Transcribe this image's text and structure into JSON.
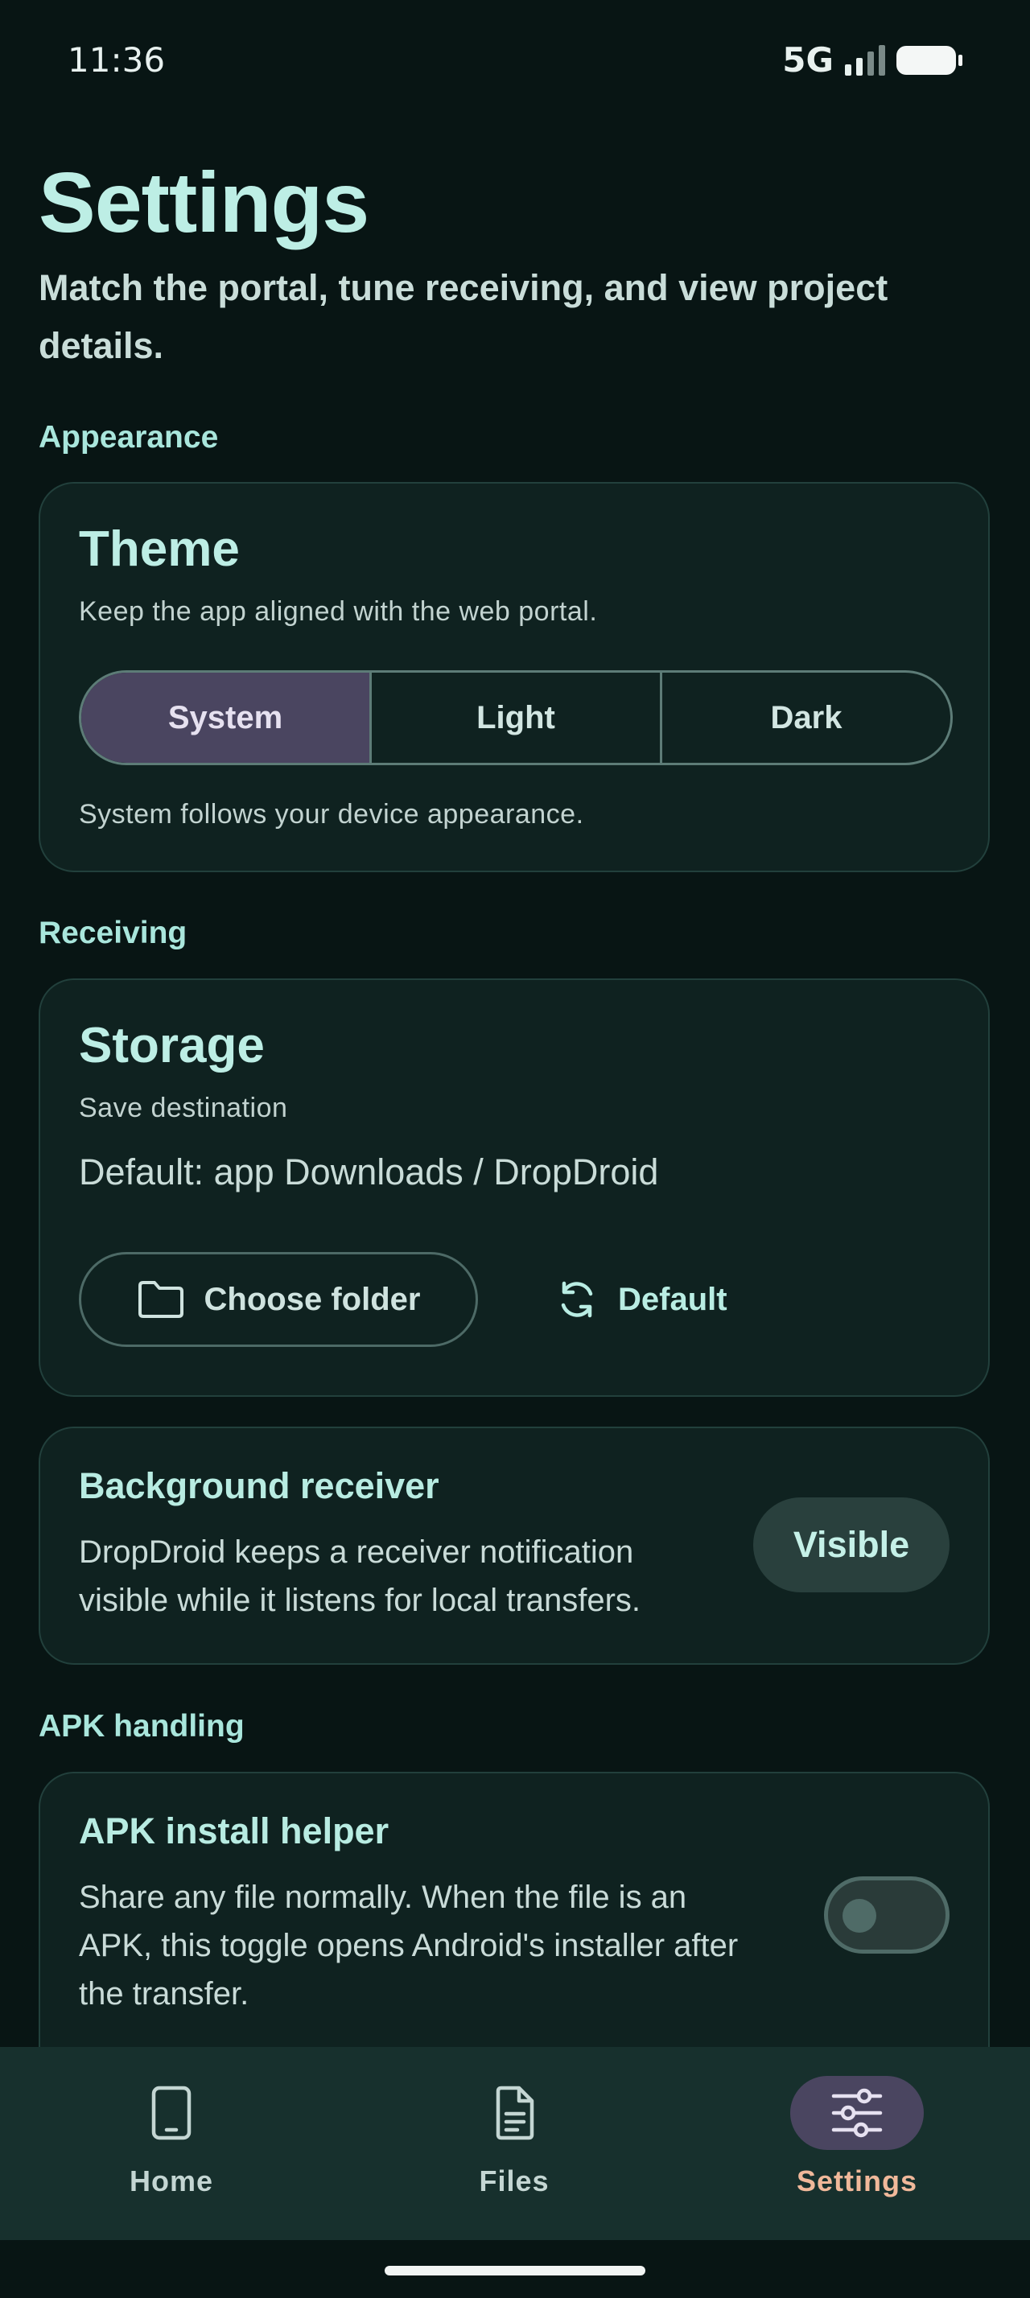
{
  "status_bar": {
    "time": "11:36",
    "network": "5G"
  },
  "header": {
    "title": "Settings",
    "subtitle": "Match the portal, tune receiving, and view project details."
  },
  "appearance": {
    "section_label": "Appearance",
    "card_title": "Theme",
    "card_desc": "Keep the app aligned with the web portal.",
    "options": [
      "System",
      "Light",
      "Dark"
    ],
    "selected": "System",
    "hint": "System follows your device appearance."
  },
  "receiving": {
    "section_label": "Receiving",
    "storage": {
      "title": "Storage",
      "subtitle": "Save destination",
      "path": "Default: app Downloads / DropDroid",
      "choose_label": "Choose folder",
      "default_label": "Default"
    },
    "background": {
      "title": "Background receiver",
      "desc": "DropDroid keeps a receiver notification visible while it listens for local transfers.",
      "button_label": "Visible"
    }
  },
  "apk": {
    "section_label": "APK handling",
    "title": "APK install helper",
    "desc": "Share any file normally. When the file is an APK, this toggle opens Android's installer after the transfer.",
    "toggle_on": false
  },
  "nav": {
    "items": [
      {
        "label": "Home",
        "icon": "phone-icon"
      },
      {
        "label": "Files",
        "icon": "document-icon"
      },
      {
        "label": "Settings",
        "icon": "sliders-icon"
      }
    ],
    "active": "Settings"
  },
  "colors": {
    "background": "#081514",
    "accent": "#bdeee5",
    "selected": "#4a4560",
    "nav_active_label": "#f0b89a"
  }
}
